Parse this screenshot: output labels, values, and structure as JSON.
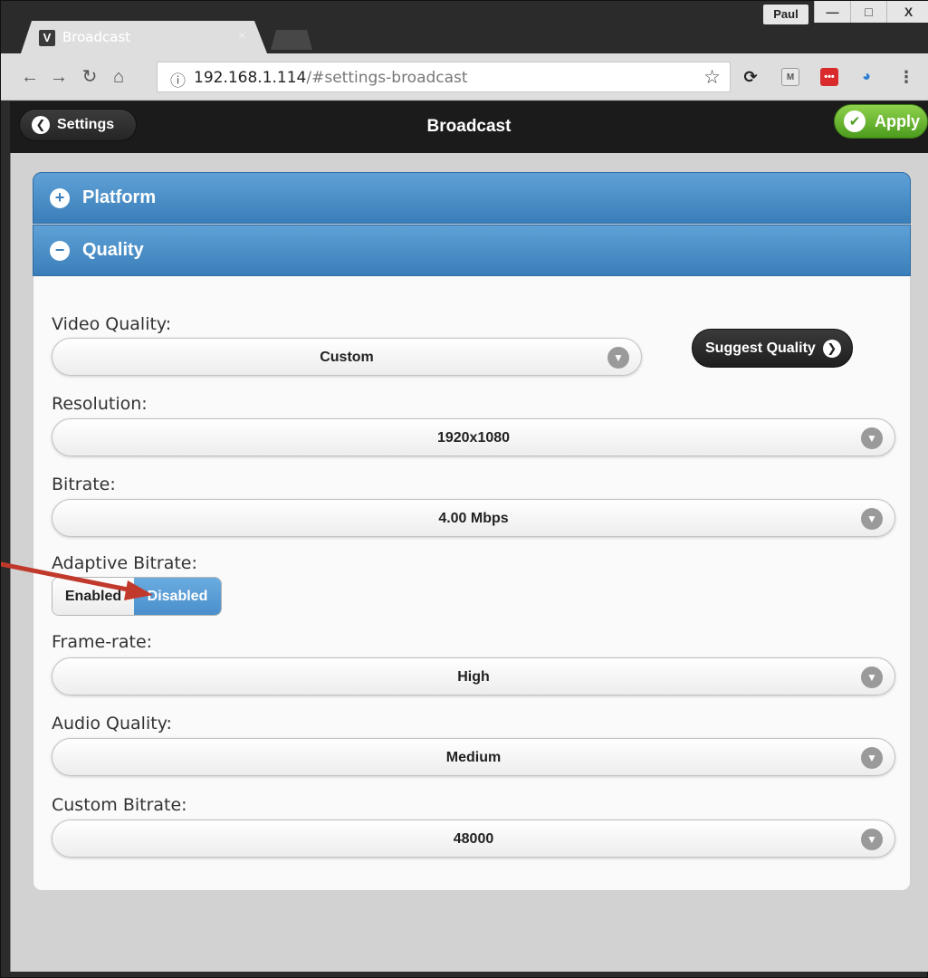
{
  "browser": {
    "tab_title": "Broadcast",
    "tab_close": "×",
    "profile_name": "Paul",
    "url_host": "192.168.1.114",
    "url_path": "/#settings-broadcast",
    "window_minimize": "—",
    "window_maximize": "□",
    "window_close": "X"
  },
  "header": {
    "back_label": "Settings",
    "title": "Broadcast",
    "apply_label": "Apply"
  },
  "sections": {
    "platform_label": "Platform",
    "quality_label": "Quality"
  },
  "quality": {
    "video_quality_label": "Video Quality:",
    "video_quality_value": "Custom",
    "suggest_label": "Suggest Quality",
    "resolution_label": "Resolution:",
    "resolution_value": "1920x1080",
    "bitrate_label": "Bitrate:",
    "bitrate_value": "4.00 Mbps",
    "adaptive_label": "Adaptive Bitrate:",
    "adaptive_options": [
      "Enabled",
      "Disabled"
    ],
    "adaptive_selected": "Disabled",
    "framerate_label": "Frame-rate:",
    "framerate_value": "High",
    "audio_label": "Audio Quality:",
    "audio_value": "Medium",
    "custom_bitrate_label": "Custom Bitrate:",
    "custom_bitrate_value": "48000"
  },
  "icons": {
    "back": "chevron-left-icon",
    "apply": "check-icon",
    "expand": "plus-icon",
    "collapse": "minus-icon",
    "select": "chevron-down-icon",
    "suggest": "chevron-right-icon"
  },
  "colors": {
    "accent_blue": "#3a7eb9",
    "apply_green": "#4c9c1e",
    "header_black": "#1b1b1b",
    "annotation_red": "#c0392b"
  }
}
